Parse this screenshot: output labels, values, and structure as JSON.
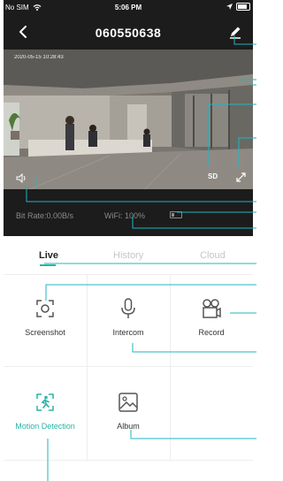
{
  "status_bar": {
    "carrier": "No SIM",
    "time": "5:06 PM"
  },
  "nav": {
    "title": "060550638"
  },
  "video": {
    "timestamp": "2020-05-15 10:28:43",
    "quality": "SD"
  },
  "info": {
    "bit_rate": "Bit Rate:0.00B/s",
    "wifi": "WiFi: 100%"
  },
  "tabs": [
    {
      "label": "Live"
    },
    {
      "label": "History"
    },
    {
      "label": "Cloud"
    }
  ],
  "actions": [
    {
      "label": "Screenshot",
      "icon": "screenshot-icon"
    },
    {
      "label": "Intercom",
      "icon": "microphone-icon"
    },
    {
      "label": "Record",
      "icon": "record-icon"
    },
    {
      "label": "Motion Detection",
      "icon": "motion-detection-icon"
    },
    {
      "label": "Album",
      "icon": "album-icon"
    }
  ],
  "colors": {
    "accent": "#2bb3a4",
    "callout": "#1fb5c2",
    "header_bg": "#1c1c1c"
  }
}
